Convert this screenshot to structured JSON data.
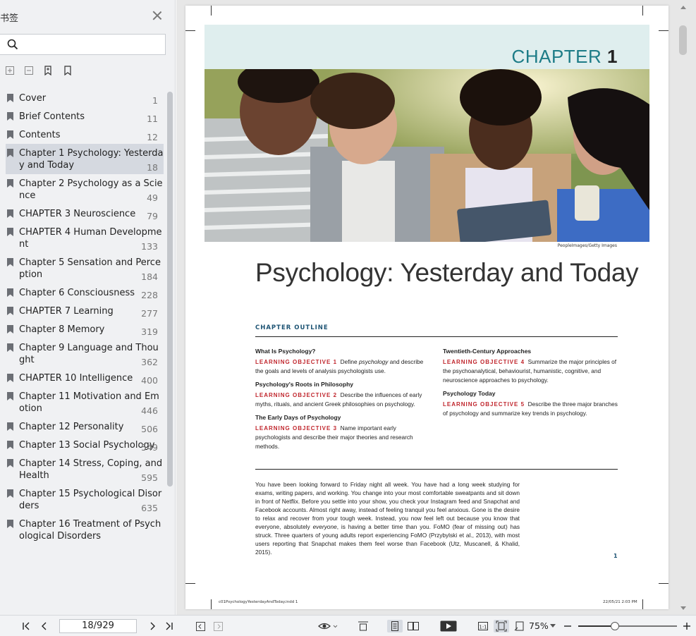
{
  "sidebar": {
    "title": "书签",
    "search_placeholder": "",
    "bookmarks": [
      {
        "label": "Cover",
        "page": "1"
      },
      {
        "label": "Brief Contents",
        "page": "11"
      },
      {
        "label": "Contents",
        "page": "12"
      },
      {
        "label": "Chapter 1 Psychology: Yesterday and Today",
        "page": "18",
        "active": true
      },
      {
        "label": "Chapter 2 Psychology as a Science",
        "page": "49"
      },
      {
        "label": "CHAPTER 3 Neuroscience",
        "page": "79"
      },
      {
        "label": "CHAPTER 4 Human Development",
        "page": "133"
      },
      {
        "label": "Chapter 5 Sensation and Perception",
        "page": "184"
      },
      {
        "label": "Chapter 6 Consciousness",
        "page": "228"
      },
      {
        "label": "CHAPTER 7 Learning",
        "page": "277"
      },
      {
        "label": "Chapter 8 Memory",
        "page": "319"
      },
      {
        "label": "Chapter 9 Language and Thought",
        "page": "362"
      },
      {
        "label": "CHAPTER 10 Intelligence",
        "page": "400"
      },
      {
        "label": "Chapter 11 Motivation and Emotion",
        "page": "446"
      },
      {
        "label": "Chapter 12 Personality",
        "page": "506"
      },
      {
        "label": "Chapter 13 Social Psychology",
        "page": "549"
      },
      {
        "label": "Chapter 14 Stress, Coping, and Health",
        "page": "595"
      },
      {
        "label": "Chapter 15 Psychological Disorders",
        "page": "635"
      },
      {
        "label": "Chapter 16 Treatment of Psychological Disorders",
        "page": ""
      }
    ]
  },
  "page": {
    "chapter_word": "CHAPTER",
    "chapter_num": "1",
    "photo_credit": "PeopleImages/Getty Images",
    "title": "Psychology: Yesterday and Today",
    "outline_heading": "CHAPTER OUTLINE",
    "outline_left": [
      {
        "heading": "What Is Psychology?",
        "lo": "LEARNING OBJECTIVE 1",
        "text_a": "Define ",
        "text_i": "psychology",
        "text_b": " and describe the goals and levels of analysis psychologists use."
      },
      {
        "heading": "Psychology's Roots in Philosophy",
        "lo": "LEARNING OBJECTIVE 2",
        "text_a": "Describe the influences of early myths, rituals, and ancient Greek philosophies on psychology.",
        "text_i": "",
        "text_b": ""
      },
      {
        "heading": "The Early Days of Psychology",
        "lo": "LEARNING OBJECTIVE 3",
        "text_a": "Name important early psychologists and describe their major theories and research methods.",
        "text_i": "",
        "text_b": ""
      }
    ],
    "outline_right": [
      {
        "heading": "Twentieth-Century Approaches",
        "lo": "LEARNING OBJECTIVE 4",
        "text_a": "Summarize the major principles of the psychoanalytical, behaviourist, humanistic, cognitive, and neuroscience approaches to psychology.",
        "text_i": "",
        "text_b": ""
      },
      {
        "heading": "Psychology Today",
        "lo": "LEARNING OBJECTIVE 5",
        "text_a": "Describe the three major branches of psychology and summarize key trends in psychology.",
        "text_i": "",
        "text_b": ""
      }
    ],
    "body_a": "You have been looking forward to Friday night all week. You have had a long week studying for exams, writing papers, and working. You change into your most comfortable sweatpants and sit down in front of Netflix. Before you settle into your show, you check your Instagram feed and Snapchat and Facebook accounts. Almost right away, instead of feeling tranquil you feel anxious. Gone is the desire to relax and recover from your tough week. Instead, you now feel left out because you know that everyone, absolutely ",
    "body_i": "everyone",
    "body_b": ", is having a better time than you. FoMO (fear of missing out) has struck. Three quarters of young adults report experiencing FoMO (Przybylski et al., 2013), with most users reporting that Snapchat makes them feel worse than Facebook (Utz, Muscanell, & Khalid, 2015).",
    "page_number": "1",
    "footer_left": "c01PsychologyYesterdayAndToday.indd   1",
    "footer_right": "22/05/21   2:03 PM"
  },
  "toolbar": {
    "page_field": "18/929",
    "zoom": "75%",
    "zoom_fraction": 0.37
  },
  "colors": {
    "chapter_teal": "#1d7c87",
    "objective_red": "#c0262d",
    "heading_navy": "#1e5474",
    "banner": "#dfeeee"
  }
}
